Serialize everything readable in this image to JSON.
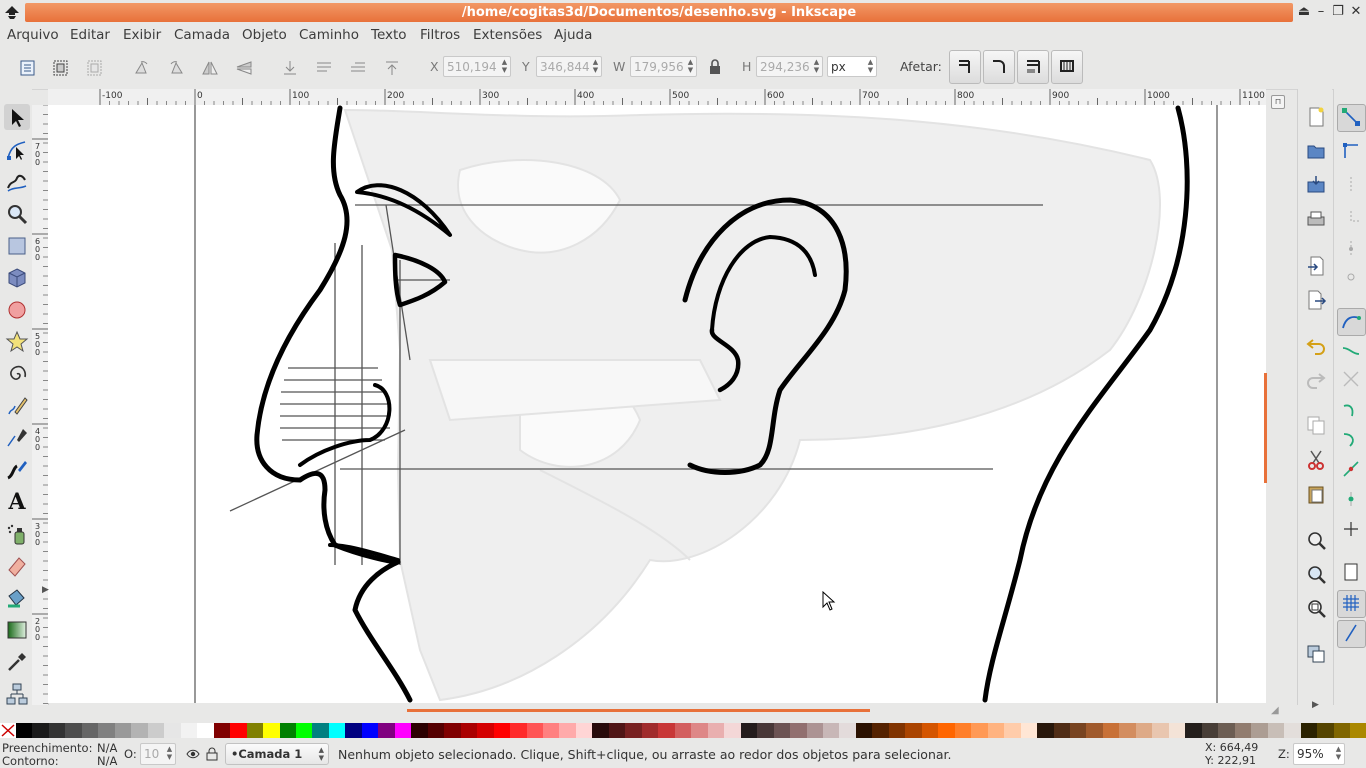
{
  "window": {
    "title": "/home/cogitas3d/Documentos/desenho.svg - Inkscape",
    "controls": [
      "⏏",
      "–",
      "❐",
      "✕"
    ]
  },
  "menu": [
    "Arquivo",
    "Editar",
    "Exibir",
    "Camada",
    "Objeto",
    "Caminho",
    "Texto",
    "Filtros",
    "Extensões",
    "Ajuda"
  ],
  "toolbar": {
    "x_label": "X",
    "x_value": "510,194",
    "y_label": "Y",
    "y_value": "346,844",
    "w_label": "W",
    "w_value": "179,956",
    "h_label": "H",
    "h_value": "294,236",
    "unit": "px",
    "affect_label": "Afetar:"
  },
  "ruler": {
    "h_labels": [
      "-100",
      "0",
      "100",
      "200",
      "300",
      "400",
      "500",
      "600",
      "700",
      "800",
      "900",
      "1000",
      "1100"
    ],
    "v_labels": [
      "7\n0\n0",
      "6\n0\n0",
      "5\n0\n0",
      "4\n0\n0",
      "3\n0\n0",
      "2\n0\n0"
    ]
  },
  "tools": [
    "selector-tool",
    "node-tool",
    "tweak-tool",
    "zoom-tool",
    "rectangle-tool",
    "box3d-tool",
    "ellipse-tool",
    "star-tool",
    "spiral-tool",
    "pencil-tool",
    "pen-tool",
    "calligraphy-tool",
    "text-tool",
    "spray-tool",
    "eraser-tool",
    "paint-bucket-tool",
    "gradient-tool",
    "dropper-tool",
    "connector-tool"
  ],
  "palette": [
    "#000000",
    "#1a1a1a",
    "#333333",
    "#4d4d4d",
    "#666666",
    "#808080",
    "#999999",
    "#b3b3b3",
    "#cccccc",
    "#e6e6e6",
    "#f2f2f2",
    "#ffffff",
    "#800000",
    "#ff0000",
    "#808000",
    "#ffff00",
    "#008000",
    "#00ff00",
    "#008080",
    "#00ffff",
    "#000080",
    "#0000ff",
    "#800080",
    "#ff00ff",
    "#2b0000",
    "#550000",
    "#800000",
    "#aa0000",
    "#d40000",
    "#ff0000",
    "#ff2a2a",
    "#ff5555",
    "#ff8080",
    "#ffaaaa",
    "#ffd5d5",
    "#280b0b",
    "#501616",
    "#782121",
    "#a02c2c",
    "#c83737",
    "#d35f5f",
    "#de8787",
    "#e9afaf",
    "#f4d7d7",
    "#241c1c",
    "#483737",
    "#6c5353",
    "#916f6f",
    "#ac9393",
    "#c8b7b7",
    "#e3dbdb",
    "#2b1100",
    "#552200",
    "#803300",
    "#aa4400",
    "#d45500",
    "#ff6600",
    "#ff7f2a",
    "#ff9955",
    "#ffb380",
    "#ffccaa",
    "#ffe6d5",
    "#28170b",
    "#502d16",
    "#784421",
    "#a05a2c",
    "#c87137",
    "#d38d5f",
    "#deaa87",
    "#e9c6af",
    "#f4e3d7",
    "#241f1c",
    "#483e37",
    "#6c5d53",
    "#917c6f",
    "#ac9d93",
    "#c8beb7",
    "#e3dedb",
    "#2b2200",
    "#554400",
    "#806600",
    "#aa8800"
  ],
  "status": {
    "fill_label": "Preenchimento:",
    "fill_value": "N/A",
    "stroke_label": "Contorno:",
    "stroke_value": "N/A",
    "opacity_label": "O:",
    "opacity_value": "10",
    "layer": "•Camada 1",
    "message": "Nenhum objeto selecionado. Clique, Shift+clique, ou arraste ao redor dos objetos para selecionar.",
    "x_coord": "X: 664,49",
    "y_coord": "Y: 222,91",
    "zoom_label": "Z:",
    "zoom_value": "95%"
  }
}
